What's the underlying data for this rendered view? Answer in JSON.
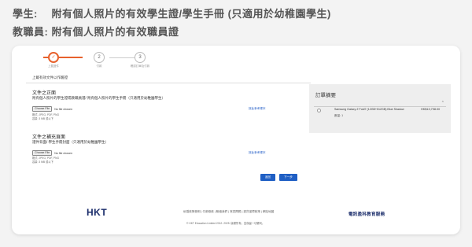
{
  "headings": {
    "students": "學生:　 附有個人照片的有效學生證/學生手冊 (只適用於幼稚園學生)",
    "staff": "教職員: 附有個人照片的有效職員證"
  },
  "steps": [
    {
      "number": "✓",
      "label": "上載證件"
    },
    {
      "number": "2",
      "label": "付款"
    },
    {
      "number": "3",
      "label": "確認訂單及付款"
    }
  ],
  "upload_note": "上載有效文件以作驗證",
  "front": {
    "title": "文件之正面",
    "subtitle": "附有個人照片的學生證或教職員證/ 附有個人照片的學生手冊（只適用於幼稚園學生）",
    "choose_button": "Choose File",
    "file_status": "No file chosen",
    "formats": "格式: JPEG, PDF, PNG",
    "size": "容量: 3 MB 或以下",
    "link": "按此參考樣本"
  },
  "back": {
    "title": "文件之補充頁面",
    "subtitle": "證件背面/ 學生手冊封面（只適用於幼稚園學生）",
    "choose_button": "Choose File",
    "file_status": "No file chosen",
    "formats": "格式: JPEG, PDF, PNG",
    "size": "容量: 3 MB 或以下",
    "link": "按此參考樣本"
  },
  "buttons": {
    "back": "返回",
    "next": "下一步"
  },
  "order_summary": {
    "title": "訂單摘要",
    "item_name": "Samsung Galaxy Z Fold7 (12GB+512GB) Blue Shadow",
    "item_price": "HK$13,798.00",
    "item_qty": "數量: 1"
  },
  "footer": {
    "logo": "HKT",
    "links": "私隱政策聲明 | 付款條款 | 聯絡我們 | 常見問題 | 退貨保障政策 | 網站地圖",
    "copyright": "© HKT Education Limited 2012- 2025. 版權所有。並保留一切權利。",
    "right_logo": "電訊盈科教育服務"
  },
  "colors": {
    "accent": "#e8612c",
    "primary_button": "#1f5fc4",
    "brand_navy": "#1b2d6b"
  }
}
